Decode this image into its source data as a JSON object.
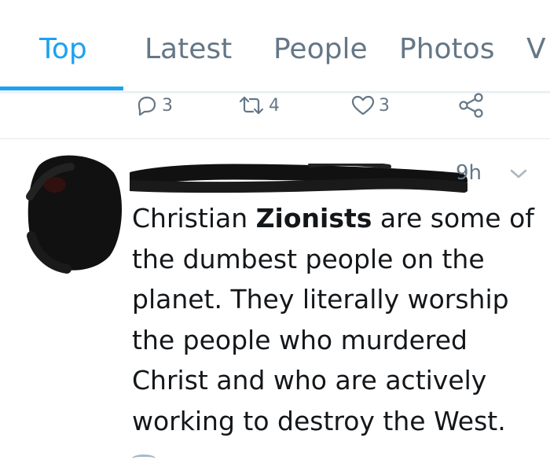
{
  "tabs": [
    {
      "label": "Top",
      "active": true
    },
    {
      "label": "Latest",
      "active": false
    },
    {
      "label": "People",
      "active": false
    },
    {
      "label": "Photos",
      "active": false
    },
    {
      "label": "V",
      "active": false
    }
  ],
  "previous_tweet_actions": {
    "reply_count": "3",
    "retweet_count": "4",
    "like_count": "3",
    "icons": [
      "reply-icon",
      "retweet-icon",
      "like-icon",
      "share-icon"
    ]
  },
  "tweet": {
    "timestamp": "9h",
    "text_before": "Christian ",
    "text_bold": "Zionists",
    "text_after": " are some of the dumbest people on the planet. They literally worship the people who murdered Christ and who are actively working to destroy the West."
  },
  "colors": {
    "accent": "#1da1f2",
    "secondary_text": "#657786",
    "divider": "#e1e8ed"
  }
}
